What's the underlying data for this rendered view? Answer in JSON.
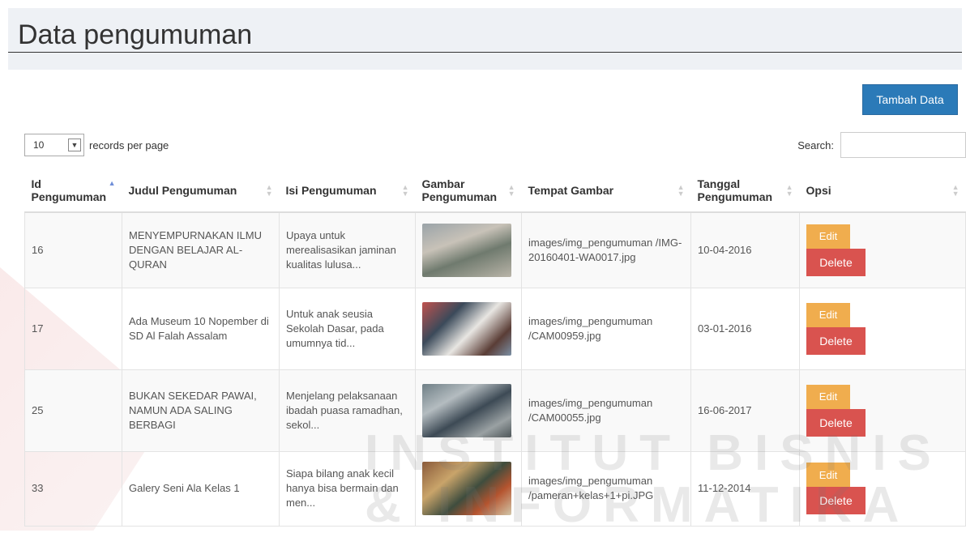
{
  "page": {
    "title": "Data pengumuman"
  },
  "toolbar": {
    "add_label": "Tambah Data",
    "length_value": "10",
    "length_label": "records per page",
    "search_label": "Search:",
    "search_value": ""
  },
  "table": {
    "columns": [
      {
        "label": "Id Pengumuman",
        "sorted": "asc"
      },
      {
        "label": "Judul Pengumuman"
      },
      {
        "label": "Isi Pengumuman"
      },
      {
        "label": "Gambar Pengumuman"
      },
      {
        "label": "Tempat Gambar"
      },
      {
        "label": "Tanggal Pengumuman"
      },
      {
        "label": "Opsi"
      }
    ],
    "rows": [
      {
        "id": "16",
        "judul": "MENYEMPURNAKAN ILMU DENGAN BELAJAR AL-QURAN",
        "isi": "Upaya untuk merealisasikan jaminan kualitas lulusa...",
        "tempat": "images/img_pengumuman /IMG-20160401-WA0017.jpg",
        "tanggal": "10-04-2016"
      },
      {
        "id": "17",
        "judul": "Ada Museum 10 Nopember di SD Al Falah Assalam",
        "isi": "Untuk anak seusia Sekolah Dasar, pada umumnya tid...",
        "tempat": "images/img_pengumuman /CAM00959.jpg",
        "tanggal": "03-01-2016"
      },
      {
        "id": "25",
        "judul": "BUKAN SEKEDAR PAWAI, NAMUN ADA SALING BERBAGI",
        "isi": "Menjelang pelaksanaan ibadah puasa ramadhan, sekol...",
        "tempat": "images/img_pengumuman /CAM00055.jpg",
        "tanggal": "16-06-2017"
      },
      {
        "id": "33",
        "judul": "Galery Seni Ala Kelas 1",
        "isi": "Siapa bilang anak kecil hanya bisa bermain dan men...",
        "tempat": "images/img_pengumuman /pameran+kelas+1+pi.JPG",
        "tanggal": "11-12-2014"
      }
    ],
    "edit_label": "Edit",
    "delete_label": "Delete"
  },
  "watermark": {
    "text_line1": "INSTITUT BISNIS",
    "text_line2": "& INFORMATIKA"
  },
  "colors": {
    "primary": "#2b7ab8",
    "warning": "#f0ad4e",
    "danger": "#d9534f"
  }
}
